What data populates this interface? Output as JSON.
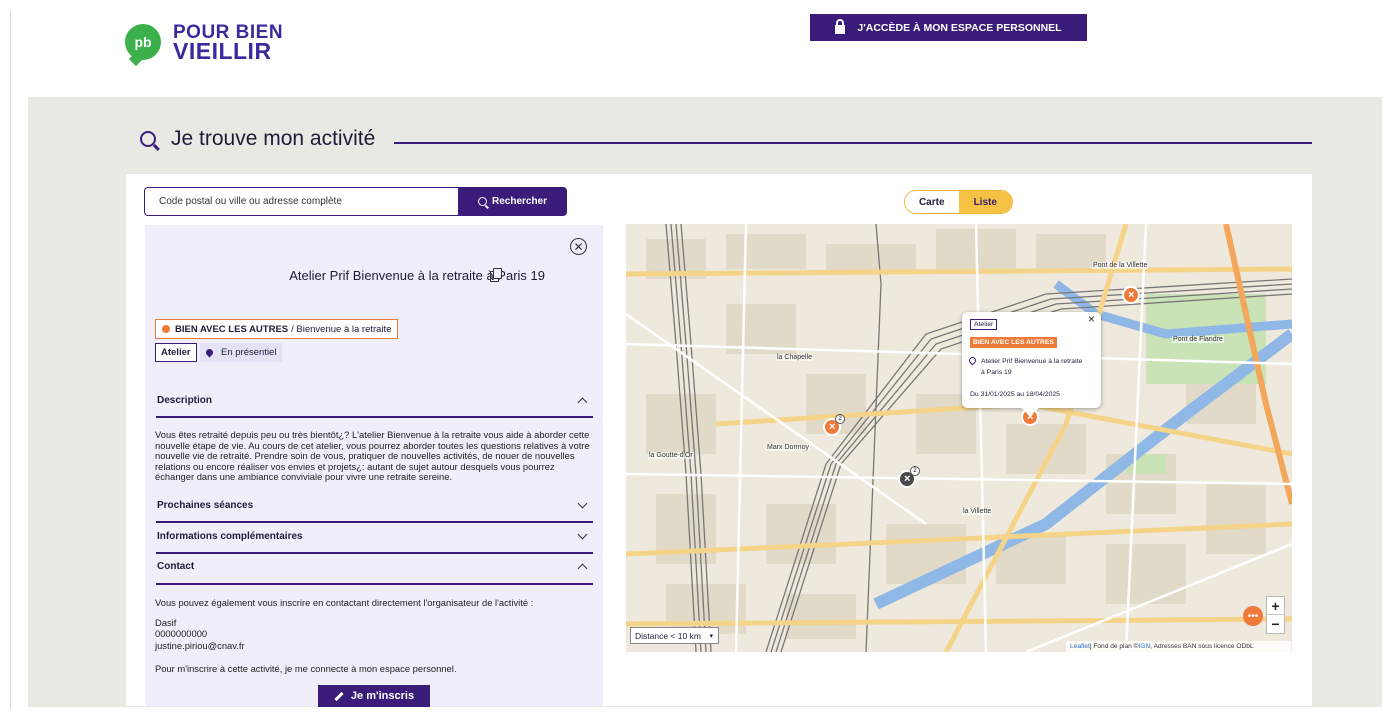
{
  "header": {
    "logo_badge": "pb",
    "logo_line1": "POUR BIEN",
    "logo_line2": "VIEILLIR",
    "access_button": "J'ACCÈDE À MON ESPACE PERSONNEL"
  },
  "page": {
    "title": "Je trouve mon activité"
  },
  "search": {
    "placeholder": "Code postal ou ville ou adresse complète",
    "button_label": "Rechercher"
  },
  "view_toggle": {
    "options": [
      "Carte",
      "Liste"
    ],
    "selected": "Carte"
  },
  "activity": {
    "title": "Atelier Prif Bienvenue à la retraite à Paris 19",
    "theme": "BIEN AVEC LES AUTRES",
    "subtheme": "/ Bienvenue à la retraite",
    "type": "Atelier",
    "mode": "En présentiel",
    "sections": {
      "description": "Description",
      "next_sessions": "Prochaines séances",
      "more_info": "Informations complémentaires",
      "contact": "Contact"
    },
    "description_text": "Vous êtes retraité depuis peu ou très bientôt¿? L'atelier Bienvenue à la retraite vous aide à aborder cette nouvelle étape de vie.  Au cours de cet atelier, vous pourrez aborder toutes les questions relatives à votre nouvelle vie de retraité. Prendre soin de vous, pratiquer de nouvelles activités, de nouer de nouvelles relations ou encore réaliser vos envies et projets¿: autant de sujet autour desquels vous pourrez échanger dans une ambiance conviviale pour vivre une retraite sereine.",
    "contact_intro": "Vous pouvez également vous inscrire en contactant directement l'organisateur de l'activité :",
    "contact_name": "Dasif",
    "contact_phone": "0000000000",
    "contact_email": "justine.piriou@cnav.fr",
    "signup_text": "Pour m'inscrire à cette activité, je me connecte à mon espace personnel.",
    "signup_button": "Je m'inscris"
  },
  "map": {
    "distance_select": "Distance < 10 km",
    "zoom_in": "+",
    "zoom_out": "−",
    "attribution_leaflet": "Leaflet",
    "attribution_rest": " | Fond de plan © ",
    "attribution_ign": "IGN",
    "attribution_end": ", Adresses BAN sous licence ODbL",
    "popup": {
      "type": "Atelier",
      "theme": "BIEN AVEC LES AUTRES",
      "title": "Atelier Prif Bienvenue à la retraite à Paris 19",
      "dates": "Du 31/01/2025 au 18/04/2025"
    },
    "labels": {
      "la_chapelle": "la Chapelle",
      "goutte_dor": "la Goutte-d'Or",
      "pont_flandre": "Pont de Flandre",
      "la_villette": "la Villette",
      "porte_villette": "Pont de la Villette",
      "marx_dormoy": "Marx Dormoy"
    },
    "marker_counts": [
      "2",
      "2"
    ]
  }
}
